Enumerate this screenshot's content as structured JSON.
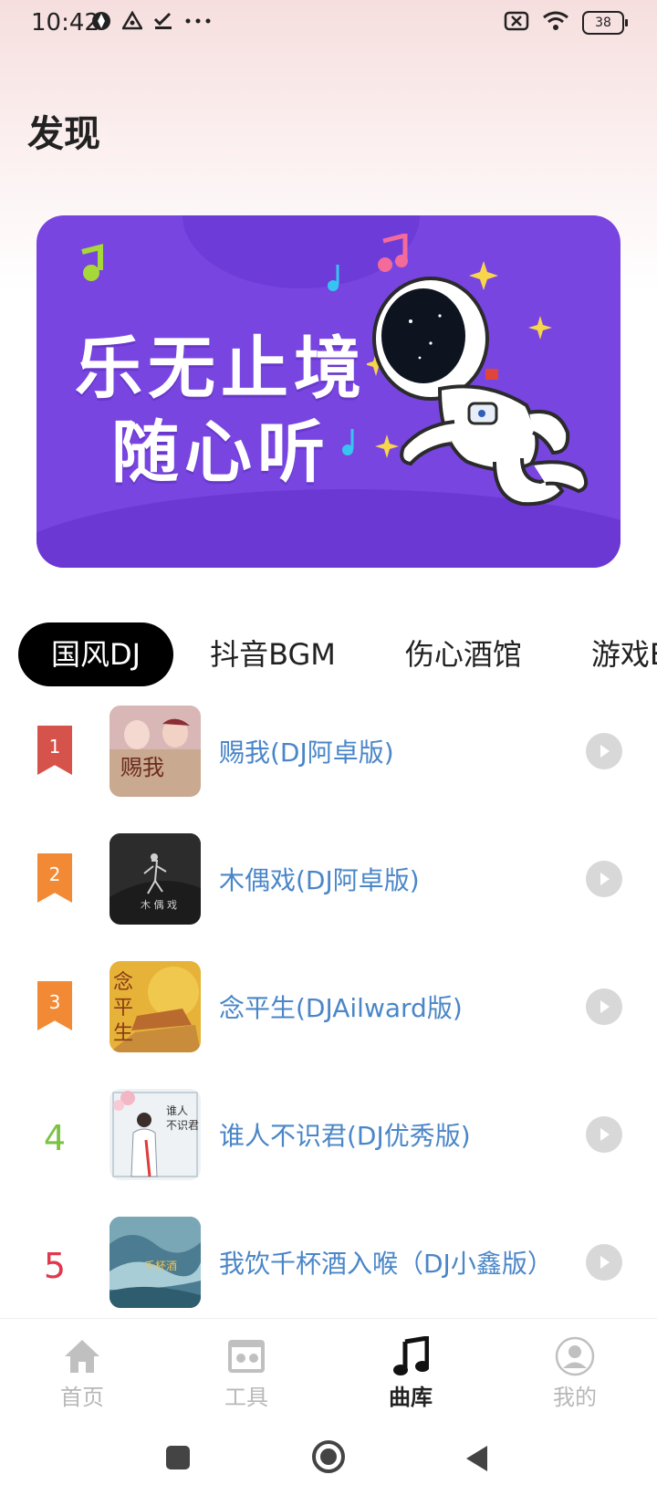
{
  "status_bar": {
    "time": "10:42",
    "battery": "38",
    "left_icons": [
      "app-icon",
      "alert-icon",
      "check-icon",
      "more-icon"
    ],
    "right_icons": [
      "sim-x-icon",
      "wifi-icon",
      "battery-icon"
    ]
  },
  "page": {
    "title": "发现"
  },
  "banner": {
    "line1": "乐无止境",
    "line2": "随心听",
    "color": "#7845e0"
  },
  "tabs": [
    {
      "label": "国风DJ",
      "active": true
    },
    {
      "label": "抖音BGM",
      "active": false
    },
    {
      "label": "伤心酒馆",
      "active": false
    },
    {
      "label": "游戏BGM",
      "active": false
    }
  ],
  "songs": [
    {
      "rank": "1",
      "title": "赐我(DJ阿卓版)",
      "rank_style": "ribbon",
      "rank_color": "#d5534a"
    },
    {
      "rank": "2",
      "title": "木偶戏(DJ阿卓版)",
      "rank_style": "ribbon",
      "rank_color": "#f28a35"
    },
    {
      "rank": "3",
      "title": "念平生(DJAilward版)",
      "rank_style": "ribbon",
      "rank_color": "#f28a35"
    },
    {
      "rank": "4",
      "title": "谁人不识君(DJ优秀版)",
      "rank_style": "text",
      "rank_color": "#7cc242"
    },
    {
      "rank": "5",
      "title": "我饮千杯酒入喉（DJ小鑫版）",
      "rank_style": "text",
      "rank_color": "#e0384f"
    }
  ],
  "bottom_nav": [
    {
      "label": "首页",
      "icon": "home-icon",
      "active": false
    },
    {
      "label": "工具",
      "icon": "tools-icon",
      "active": false
    },
    {
      "label": "曲库",
      "icon": "music-note-icon",
      "active": true
    },
    {
      "label": "我的",
      "icon": "user-icon",
      "active": false
    }
  ],
  "colors": {
    "song_title": "#4a86c8",
    "active_tab_bg": "#000000",
    "inactive_nav": "#b8b8b8"
  }
}
